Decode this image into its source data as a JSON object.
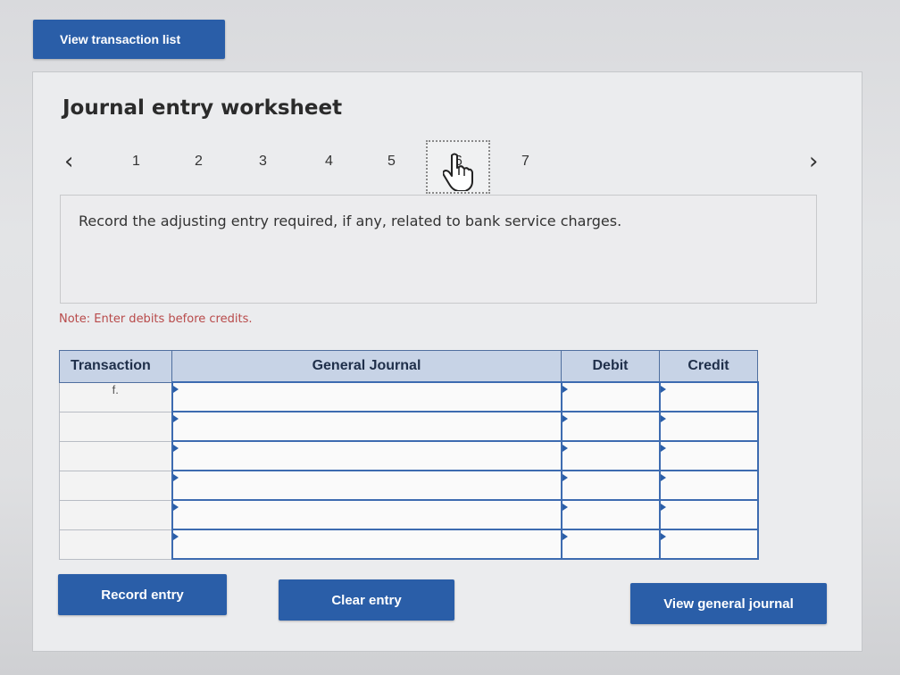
{
  "top": {
    "view_transaction_list": "View transaction list"
  },
  "worksheet": {
    "title": "Journal entry worksheet",
    "tabs": [
      "1",
      "2",
      "3",
      "4",
      "5",
      "6",
      "7"
    ],
    "active_tab": "6",
    "instruction": "Record the adjusting entry required, if any, related to bank service charges.",
    "note": "Note: Enter debits before credits."
  },
  "table": {
    "headers": {
      "transaction": "Transaction",
      "general_journal": "General Journal",
      "debit": "Debit",
      "credit": "Credit"
    },
    "rows": [
      {
        "transaction": "f.",
        "account": "",
        "debit": "",
        "credit": ""
      },
      {
        "transaction": "",
        "account": "",
        "debit": "",
        "credit": ""
      },
      {
        "transaction": "",
        "account": "",
        "debit": "",
        "credit": ""
      },
      {
        "transaction": "",
        "account": "",
        "debit": "",
        "credit": ""
      },
      {
        "transaction": "",
        "account": "",
        "debit": "",
        "credit": ""
      },
      {
        "transaction": "",
        "account": "",
        "debit": "",
        "credit": ""
      }
    ]
  },
  "buttons": {
    "record": "Record entry",
    "clear": "Clear entry",
    "view_general_journal": "View general journal"
  },
  "icons": {
    "prev": "chevron-left-icon",
    "next": "chevron-right-icon",
    "cursor": "hand-pointer-icon"
  },
  "colors": {
    "accent": "#2a5ea8",
    "note": "#b84a4a",
    "header_bg": "#c7d3e6"
  }
}
